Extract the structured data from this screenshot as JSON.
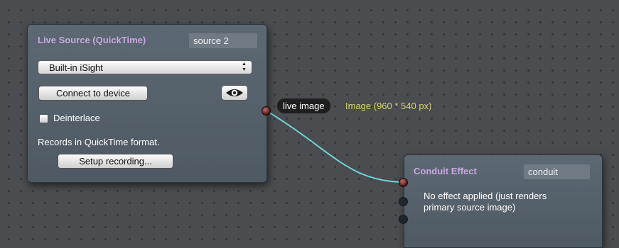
{
  "live_source": {
    "title": "Live Source (QuickTime)",
    "identifier": "source 2",
    "device_select": {
      "value": "Built-in iSight"
    },
    "connect_label": "Connect to device",
    "deinterlace_label": "Deinterlace",
    "deinterlace_checked": false,
    "record_note": "Records in QuickTime format.",
    "setup_label": "Setup recording...",
    "preview_icon": "eye-icon"
  },
  "connection": {
    "port_label": "live image",
    "type_label": "Image (960 * 540 px)",
    "wire_color": "#6ed3d8"
  },
  "conduit_effect": {
    "title": "Conduit Effect",
    "identifier": "conduit",
    "description_line1": "No effect applied (just renders",
    "description_line2": "primary source image)"
  },
  "colors": {
    "node_title": "#c8a8e0",
    "type_label": "#d3d66a",
    "canvas_bg": "#4a4c4f"
  }
}
